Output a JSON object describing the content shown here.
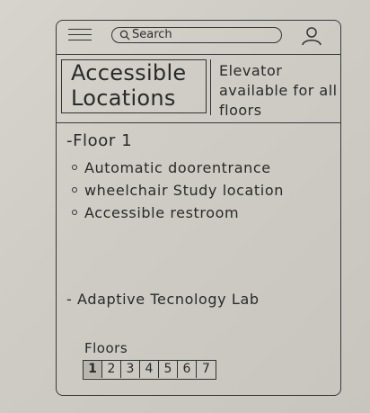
{
  "header": {
    "search_placeholder": "Search"
  },
  "title": "Accessible Locations",
  "elevator_note": "Elevator available for all floors",
  "floor": {
    "heading": "-Floor 1",
    "items": [
      {
        "label": "Automatic doorentrance"
      },
      {
        "label": "wheelchair Study location"
      },
      {
        "label": "Accessible restroom"
      }
    ]
  },
  "adaptive_lab": "- Adaptive Tecnology Lab",
  "floors_pager": {
    "label": "Floors",
    "pages": [
      "1",
      "2",
      "3",
      "4",
      "5",
      "6",
      "7"
    ],
    "selected": "1"
  },
  "icons": {
    "menu": "hamburger-menu-icon",
    "search": "search-icon",
    "profile": "profile-icon"
  }
}
